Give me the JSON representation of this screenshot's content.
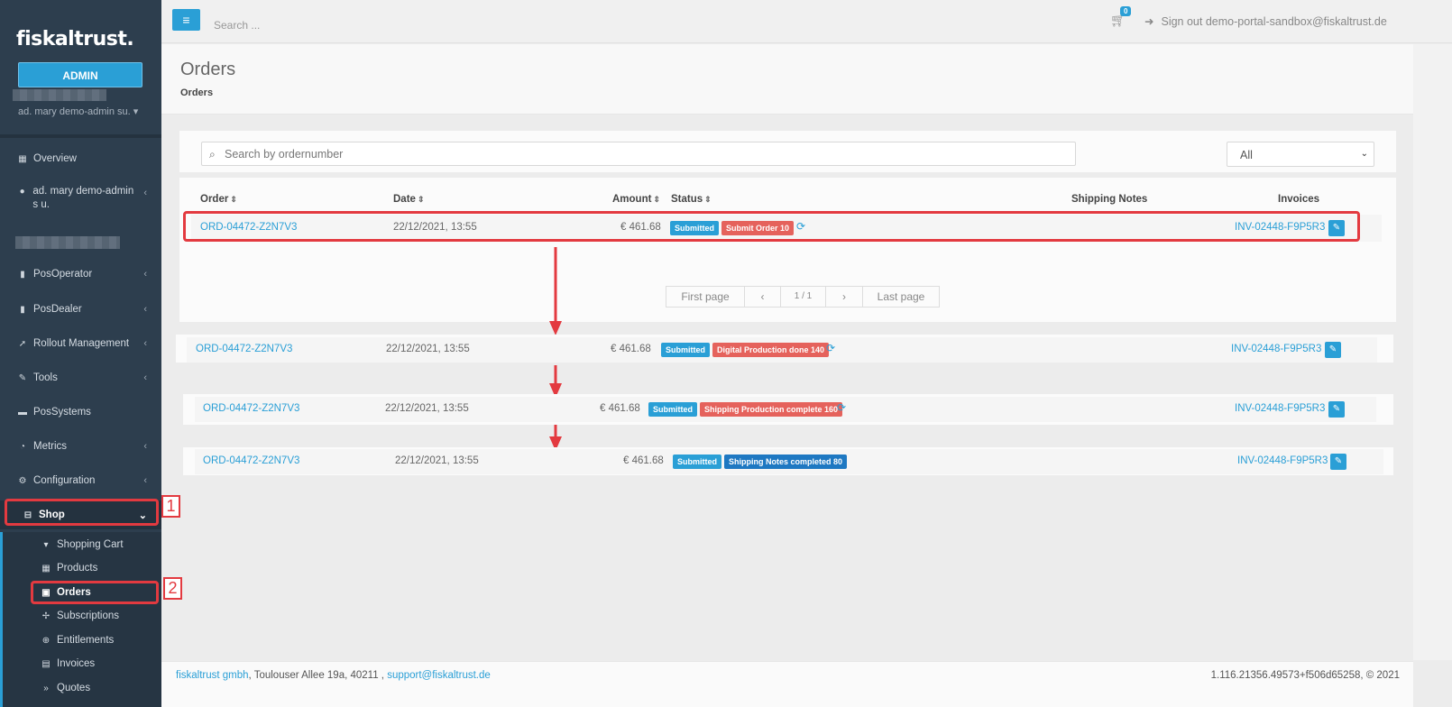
{
  "app": {
    "logo": "fiskaltrust.",
    "role_button": "ADMIN",
    "user_selector": "ad. mary demo-admin su."
  },
  "sidebar": {
    "items": [
      {
        "label": "Overview",
        "icon": "dashboard-icon"
      },
      {
        "label": "ad. mary demo-admin s u.",
        "icon": "user-icon"
      },
      {
        "label": "PosOperator",
        "icon": "building-icon"
      },
      {
        "label": "PosDealer",
        "icon": "building-icon"
      },
      {
        "label": "Rollout Management",
        "icon": "rocket-icon"
      },
      {
        "label": "Tools",
        "icon": "wrench-icon"
      },
      {
        "label": "PosSystems",
        "icon": "briefcase-icon"
      },
      {
        "label": "Metrics",
        "icon": "pie-chart-icon"
      },
      {
        "label": "Configuration",
        "icon": "gears-icon"
      },
      {
        "label": "Shop",
        "icon": "basket-icon"
      }
    ],
    "shop_submenu": [
      {
        "label": "Shopping Cart",
        "icon": "cart-icon"
      },
      {
        "label": "Products",
        "icon": "calculator-icon"
      },
      {
        "label": "Orders",
        "icon": "shopping-bag-icon"
      },
      {
        "label": "Subscriptions",
        "icon": "pushpin-icon"
      },
      {
        "label": "Entitlements",
        "icon": "circle-arrow-icon"
      },
      {
        "label": "Invoices",
        "icon": "file-icon"
      },
      {
        "label": "Quotes",
        "icon": "quote-icon"
      }
    ]
  },
  "topbar": {
    "search_placeholder": "Search ...",
    "cart_count": "0",
    "signout_label": "Sign out demo-portal-sandbox@fiskaltrust.de"
  },
  "page": {
    "title": "Orders",
    "breadcrumb": "Orders"
  },
  "filters": {
    "search_placeholder": "Search by ordernumber",
    "status_selected": "All"
  },
  "table": {
    "columns": [
      "Order",
      "Date",
      "Amount",
      "Status",
      "Shipping Notes",
      "Invoices"
    ],
    "rows": [
      {
        "order": "ORD-04472-Z2N7V3",
        "date": "22/12/2021, 13:55",
        "amount": "€ 461.68",
        "status": "Submitted",
        "stage": "Submit Order 10",
        "stage_color": "#e5625c",
        "invoice": "INV-02448-F9P5R3"
      },
      {
        "order": "ORD-04472-Z2N7V3",
        "date": "22/12/2021, 13:55",
        "amount": "€ 461.68",
        "status": "Submitted",
        "stage": "Digital Production done 140",
        "stage_color": "#e5625c",
        "invoice": "INV-02448-F9P5R3"
      },
      {
        "order": "ORD-04472-Z2N7V3",
        "date": "22/12/2021, 13:55",
        "amount": "€ 461.68",
        "status": "Submitted",
        "stage": "Shipping Production complete 160",
        "stage_color": "#e5625c",
        "invoice": "INV-02448-F9P5R3"
      },
      {
        "order": "ORD-04472-Z2N7V3",
        "date": "22/12/2021, 13:55",
        "amount": "€ 461.68",
        "status": "Submitted",
        "stage": "Shipping Notes completed 80",
        "stage_color": "#1e78c2",
        "invoice": "INV-02448-F9P5R3"
      }
    ]
  },
  "pagination": {
    "first": "First page",
    "prev": "‹",
    "current": "1 / 1",
    "next": "›",
    "last": "Last page"
  },
  "annotations": {
    "step1": "1",
    "step2": "2"
  },
  "footer": {
    "company": "fiskaltrust gmbh",
    "address": ", Toulouser Allee 19a, 40211 , ",
    "email": "support@fiskaltrust.de",
    "version": "1.116.21356.49573+f506d65258, © 2021"
  },
  "colors": {
    "accent": "#2a9fd6",
    "sidebar": "#2d3e4e",
    "highlight": "#e33a40"
  }
}
